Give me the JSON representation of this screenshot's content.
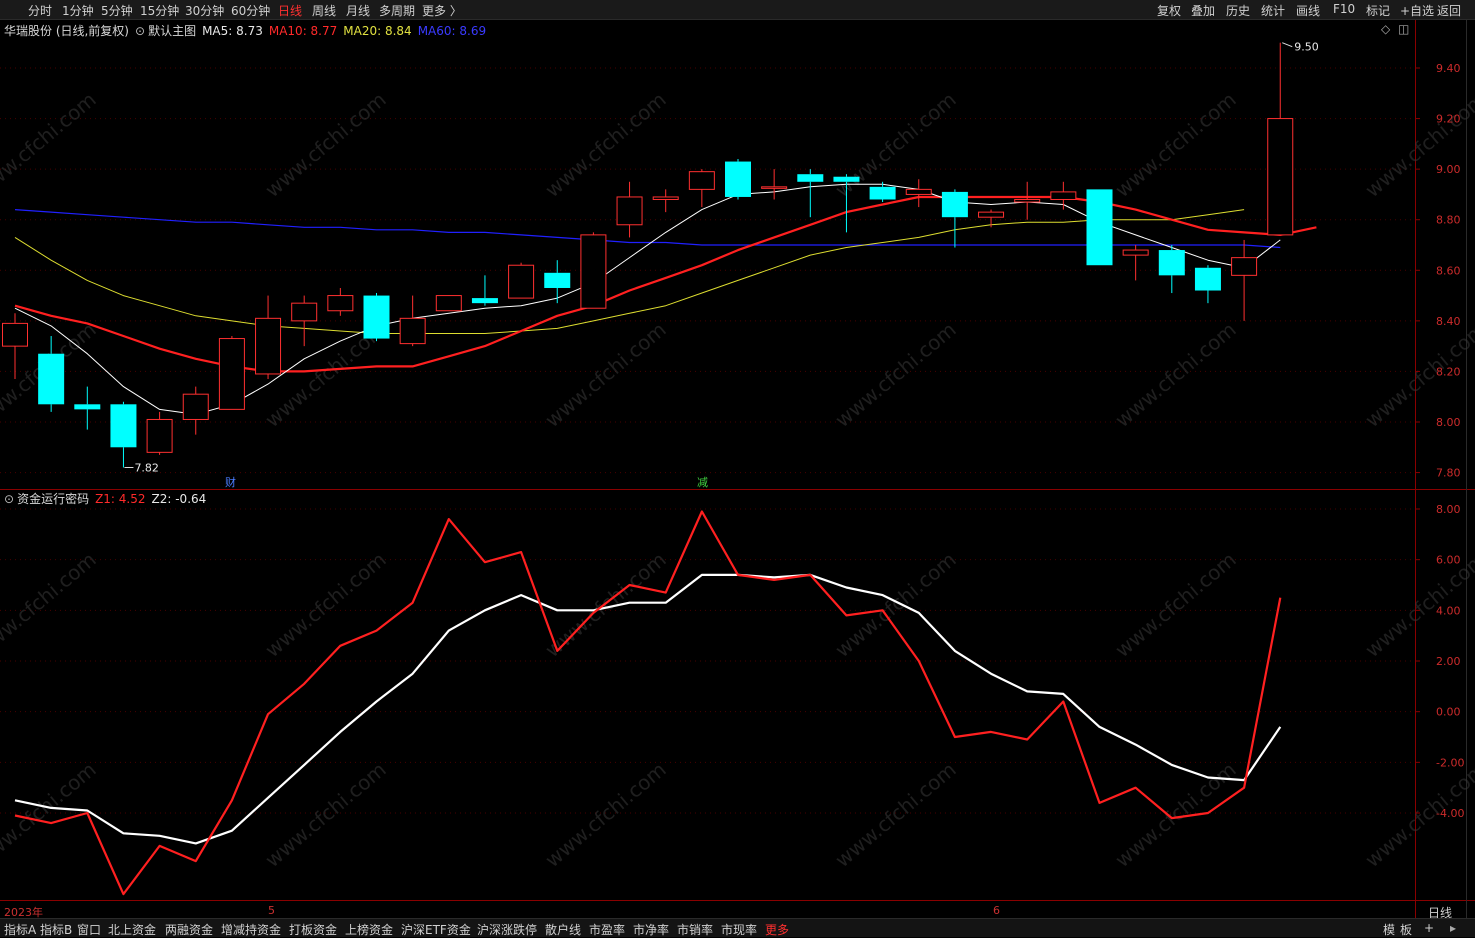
{
  "toolbar": {
    "periods": [
      "分时",
      "1分钟",
      "5分钟",
      "15分钟",
      "30分钟",
      "60分钟",
      "日线",
      "周线",
      "月线",
      "多周期",
      "更多 〉"
    ],
    "active_period": "日线",
    "right_buttons": [
      "复权",
      "叠加",
      "历史",
      "统计",
      "画线",
      "F10",
      "标记",
      "+自选",
      "返回"
    ]
  },
  "main_chart": {
    "stock_title": "华瑞股份 (日线,前复权)",
    "indicator_name": "默认主图",
    "ma5_label": "MA5: 8.73",
    "ma10_label": "MA10: 8.77",
    "ma20_label": "MA20: 8.84",
    "ma60_label": "MA60: 8.69",
    "high_label": "9.50",
    "low_label": "7.82",
    "marker_cai": "财",
    "marker_jian": "减",
    "y_ticks": [
      "9.40",
      "9.20",
      "9.00",
      "8.80",
      "8.60",
      "8.40",
      "8.20",
      "8.00",
      "7.80"
    ],
    "watermark": "www.cfchi.com"
  },
  "sub_chart": {
    "indicator_name": "资金运行密码",
    "z1_label": "Z1: 4.52",
    "z2_label": "Z2: -0.64",
    "y_ticks": [
      "8.00",
      "6.00",
      "4.00",
      "2.00",
      "0.00",
      "-2.00",
      "-4.00"
    ]
  },
  "x_axis": {
    "labels": [
      "2023年",
      "5",
      "6"
    ],
    "period_label": "日线"
  },
  "bottom_tabs": {
    "items": [
      "指标A",
      "指标B",
      "窗口",
      "北上资金",
      "两融资金",
      "增减持资金",
      "打板资金",
      "上榜资金",
      "沪深ETF资金",
      "沪深涨跌停",
      "散户线",
      "市盈率",
      "市净率",
      "市销率",
      "市现率",
      "更多"
    ],
    "active": "更多",
    "right_items": [
      "模",
      "板",
      "+"
    ]
  },
  "colors": {
    "up": "#ff3030",
    "down": "#00ffff",
    "ma5": "#ffffff",
    "ma10": "#ff2020",
    "ma20": "#dddd30",
    "ma60": "#2020ff",
    "z1": "#ff2020",
    "z2": "#ffffff",
    "grid": "#4a0000"
  },
  "chart_data": [
    {
      "type": "candlestick",
      "title": "华瑞股份 (日线,前复权)",
      "y_range": [
        7.75,
        9.55
      ],
      "candles": [
        {
          "o": 8.3,
          "h": 8.43,
          "l": 8.17,
          "c": 8.39
        },
        {
          "o": 8.27,
          "h": 8.34,
          "l": 8.04,
          "c": 8.07
        },
        {
          "o": 8.07,
          "h": 8.14,
          "l": 7.97,
          "c": 8.05
        },
        {
          "o": 8.07,
          "h": 8.08,
          "l": 7.82,
          "c": 7.9
        },
        {
          "o": 7.88,
          "h": 8.04,
          "l": 7.87,
          "c": 8.01
        },
        {
          "o": 8.01,
          "h": 8.14,
          "l": 7.95,
          "c": 8.11
        },
        {
          "o": 8.05,
          "h": 8.34,
          "l": 8.05,
          "c": 8.33
        },
        {
          "o": 8.19,
          "h": 8.5,
          "l": 8.17,
          "c": 8.41
        },
        {
          "o": 8.4,
          "h": 8.5,
          "l": 8.3,
          "c": 8.47
        },
        {
          "o": 8.44,
          "h": 8.53,
          "l": 8.42,
          "c": 8.5
        },
        {
          "o": 8.5,
          "h": 8.51,
          "l": 8.32,
          "c": 8.33
        },
        {
          "o": 8.31,
          "h": 8.5,
          "l": 8.3,
          "c": 8.41
        },
        {
          "o": 8.44,
          "h": 8.5,
          "l": 8.44,
          "c": 8.5
        },
        {
          "o": 8.49,
          "h": 8.58,
          "l": 8.46,
          "c": 8.47
        },
        {
          "o": 8.49,
          "h": 8.63,
          "l": 8.49,
          "c": 8.62
        },
        {
          "o": 8.59,
          "h": 8.64,
          "l": 8.47,
          "c": 8.53
        },
        {
          "o": 8.45,
          "h": 8.75,
          "l": 8.45,
          "c": 8.74
        },
        {
          "o": 8.78,
          "h": 8.95,
          "l": 8.73,
          "c": 8.89
        },
        {
          "o": 8.88,
          "h": 8.92,
          "l": 8.83,
          "c": 8.89
        },
        {
          "o": 8.92,
          "h": 9.0,
          "l": 8.85,
          "c": 8.99
        },
        {
          "o": 9.03,
          "h": 9.04,
          "l": 8.88,
          "c": 8.89
        },
        {
          "o": 8.93,
          "h": 9.0,
          "l": 8.88,
          "c": 8.93
        },
        {
          "o": 8.98,
          "h": 9.0,
          "l": 8.81,
          "c": 8.95
        },
        {
          "o": 8.97,
          "h": 8.98,
          "l": 8.75,
          "c": 8.95
        },
        {
          "o": 8.93,
          "h": 8.95,
          "l": 8.87,
          "c": 8.88
        },
        {
          "o": 8.9,
          "h": 8.96,
          "l": 8.85,
          "c": 8.92
        },
        {
          "o": 8.91,
          "h": 8.92,
          "l": 8.69,
          "c": 8.81
        },
        {
          "o": 8.81,
          "h": 8.84,
          "l": 8.77,
          "c": 8.83
        },
        {
          "o": 8.87,
          "h": 8.95,
          "l": 8.8,
          "c": 8.88
        },
        {
          "o": 8.88,
          "h": 8.95,
          "l": 8.84,
          "c": 8.91
        },
        {
          "o": 8.92,
          "h": 8.92,
          "l": 8.62,
          "c": 8.62
        },
        {
          "o": 8.66,
          "h": 8.7,
          "l": 8.56,
          "c": 8.68
        },
        {
          "o": 8.68,
          "h": 8.7,
          "l": 8.51,
          "c": 8.58
        },
        {
          "o": 8.61,
          "h": 8.62,
          "l": 8.47,
          "c": 8.52
        },
        {
          "o": 8.58,
          "h": 8.72,
          "l": 8.4,
          "c": 8.65
        },
        {
          "o": 8.74,
          "h": 9.5,
          "l": 8.74,
          "c": 9.2
        }
      ],
      "ma5": [
        8.45,
        8.38,
        8.27,
        8.14,
        8.05,
        8.03,
        8.07,
        8.15,
        8.25,
        8.32,
        8.38,
        8.41,
        8.43,
        8.45,
        8.46,
        8.49,
        8.55,
        8.65,
        8.75,
        8.84,
        8.9,
        8.91,
        8.93,
        8.94,
        8.94,
        8.92,
        8.87,
        8.86,
        8.87,
        8.86,
        8.79,
        8.74,
        8.69,
        8.64,
        8.61,
        8.72
      ],
      "ma10": [
        8.46,
        8.42,
        8.39,
        8.34,
        8.29,
        8.25,
        8.22,
        8.2,
        8.2,
        8.21,
        8.22,
        8.22,
        8.26,
        8.3,
        8.36,
        8.42,
        8.46,
        8.52,
        8.57,
        8.62,
        8.68,
        8.73,
        8.78,
        8.83,
        8.86,
        8.89,
        8.89,
        8.89,
        8.89,
        8.89,
        8.87,
        8.84,
        8.8,
        8.76,
        8.75,
        8.74,
        8.77
      ],
      "ma20": [
        8.73,
        8.64,
        8.56,
        8.5,
        8.46,
        8.42,
        8.4,
        8.38,
        8.37,
        8.36,
        8.35,
        8.35,
        8.35,
        8.35,
        8.36,
        8.37,
        8.4,
        8.43,
        8.46,
        8.51,
        8.56,
        8.61,
        8.66,
        8.69,
        8.71,
        8.73,
        8.76,
        8.78,
        8.79,
        8.79,
        8.8,
        8.8,
        8.8,
        8.82,
        8.84
      ],
      "ma60": [
        8.84,
        8.83,
        8.82,
        8.81,
        8.8,
        8.79,
        8.79,
        8.78,
        8.77,
        8.77,
        8.76,
        8.76,
        8.75,
        8.75,
        8.74,
        8.73,
        8.72,
        8.71,
        8.71,
        8.7,
        8.7,
        8.7,
        8.7,
        8.7,
        8.7,
        8.7,
        8.7,
        8.7,
        8.7,
        8.7,
        8.7,
        8.7,
        8.7,
        8.7,
        8.7,
        8.69
      ]
    },
    {
      "type": "line",
      "title": "资金运行密码",
      "y_range": [
        -7.6,
        8.4
      ],
      "series": [
        {
          "name": "Z1",
          "values": [
            -4.1,
            -4.4,
            -4.0,
            -7.2,
            -5.3,
            -5.9,
            -3.5,
            -0.1,
            1.1,
            2.6,
            3.2,
            4.3,
            7.6,
            5.9,
            6.3,
            2.4,
            3.9,
            5.0,
            4.7,
            7.9,
            5.4,
            5.2,
            5.4,
            3.8,
            4.0,
            2.0,
            -1.0,
            -0.8,
            -1.1,
            0.4,
            -3.6,
            -3.0,
            -4.2,
            -4.0,
            -3.0,
            4.5
          ]
        },
        {
          "name": "Z2",
          "values": [
            -3.5,
            -3.8,
            -3.9,
            -4.8,
            -4.9,
            -5.2,
            -4.7,
            -3.4,
            -2.1,
            -0.8,
            0.4,
            1.5,
            3.2,
            4.0,
            4.6,
            4.0,
            4.0,
            4.3,
            4.3,
            5.4,
            5.4,
            5.3,
            5.4,
            4.9,
            4.6,
            3.9,
            2.4,
            1.5,
            0.8,
            0.7,
            -0.6,
            -1.3,
            -2.1,
            -2.6,
            -2.7,
            -0.6
          ]
        }
      ]
    }
  ]
}
